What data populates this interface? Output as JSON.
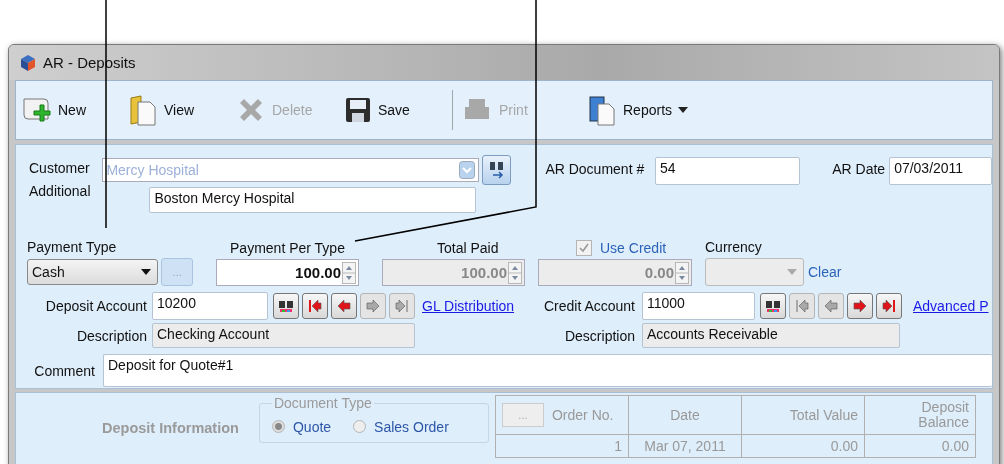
{
  "window": {
    "title": "AR - Deposits"
  },
  "toolbar": [
    {
      "label": "New",
      "kind": "new",
      "disabled": false
    },
    {
      "label": "View",
      "kind": "view",
      "disabled": false
    },
    {
      "label": "Delete",
      "kind": "delete",
      "disabled": true
    },
    {
      "label": "Save",
      "kind": "save",
      "disabled": false
    },
    {
      "label": "Print",
      "kind": "print",
      "disabled": true
    },
    {
      "label": "Reports",
      "kind": "reports",
      "disabled": false
    }
  ],
  "customer": {
    "label": "Customer",
    "value": "Mercy Hospital",
    "disabled": true
  },
  "additional": {
    "label": "Additional",
    "value": "Boston Mercy Hospital"
  },
  "ar_document": {
    "label": "AR Document #",
    "value": "54"
  },
  "ar_date": {
    "label": "AR Date",
    "value": "07/03/2011"
  },
  "payment_type": {
    "label": "Payment Type",
    "value": "Cash",
    "button": "..."
  },
  "payment_per_type": {
    "label": "Payment Per Type",
    "value": "100.00"
  },
  "total_paid": {
    "label": "Total Paid",
    "value": "100.00"
  },
  "use_credit": {
    "label": "Use Credit",
    "checked": true,
    "disabled": true,
    "value": "0.00"
  },
  "currency": {
    "label": "Currency",
    "clear": "Clear"
  },
  "deposit_account": {
    "label": "Deposit Account",
    "value": "10200",
    "link": "GL Distribution",
    "description_label": "Description",
    "description": "Checking Account",
    "nav": [
      {
        "kind": "find",
        "disabled": false
      },
      {
        "kind": "first",
        "disabled": false
      },
      {
        "kind": "prev",
        "disabled": false
      },
      {
        "kind": "next",
        "disabled": true
      },
      {
        "kind": "last",
        "disabled": true
      }
    ]
  },
  "credit_account": {
    "label": "Credit Account",
    "value": "11000",
    "link": "Advanced P",
    "description_label": "Description",
    "description": "Accounts Receivable",
    "nav": [
      {
        "kind": "find",
        "disabled": false
      },
      {
        "kind": "first",
        "disabled": true
      },
      {
        "kind": "prev",
        "disabled": true
      },
      {
        "kind": "next",
        "disabled": false
      },
      {
        "kind": "last",
        "disabled": false
      }
    ]
  },
  "comment": {
    "label": "Comment",
    "value": "Deposit for Quote#1"
  },
  "deposit_information": {
    "title": "Deposit Information",
    "document_type": {
      "label": "Document Type",
      "options": [
        {
          "label": "Quote",
          "selected": true
        },
        {
          "label": "Sales Order",
          "selected": false
        }
      ]
    }
  },
  "table": {
    "button": "...",
    "columns": [
      "Order No.",
      "Date",
      "Total Value",
      "Deposit Balance"
    ],
    "rows": [
      [
        "1",
        "Mar 07, 2011",
        "0.00",
        "0.00"
      ]
    ]
  }
}
